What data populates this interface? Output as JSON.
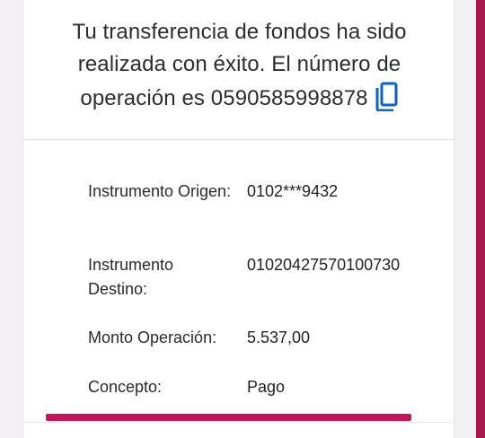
{
  "confirmation": {
    "message_line1": "Tu transferencia de fondos ha sido",
    "message_line2": "realizada con éxito. El número de",
    "message_line3_prefix": "operación es",
    "operation_number": "0590585998878",
    "copy_icon": "copy-icon"
  },
  "details": [
    {
      "label": "Instrumento Origen:",
      "value": "0102***9432"
    },
    {
      "label": "Instrumento Destino:",
      "value": "01020427570100730"
    },
    {
      "label": "Monto Operación:",
      "value": "5.537,00"
    },
    {
      "label": "Concepto:",
      "value": "Pago"
    }
  ],
  "colors": {
    "accent": "#c2185b",
    "edge": "#a7194b",
    "icon": "#0b63c8",
    "text": "#2d2d2d"
  }
}
